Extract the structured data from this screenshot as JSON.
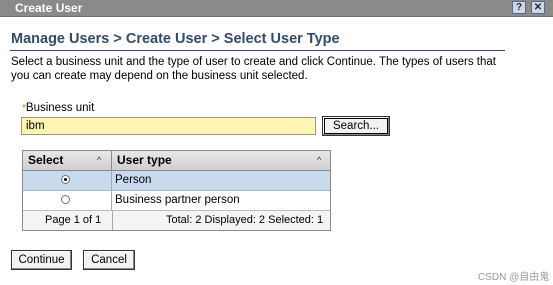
{
  "window": {
    "title": "Create User",
    "help_glyph": "?",
    "close_glyph": "✕"
  },
  "page": {
    "heading": "Manage Users > Create User > Select User Type",
    "description": "Select a business unit and the type of user to create and click Continue. The types of users that you can create may depend on the business unit selected."
  },
  "business_unit": {
    "required_marker": "*",
    "label": "Business unit",
    "value": "ibm",
    "search_label": "Search..."
  },
  "table": {
    "columns": [
      "Select",
      "User type"
    ],
    "sort_glyph": "^",
    "rows": [
      {
        "type": "Person",
        "selected": true
      },
      {
        "type": "Business partner person",
        "selected": false
      }
    ],
    "page_info": "Page 1 of 1",
    "stats": "Total: 2  Displayed: 2  Selected: 1"
  },
  "actions": {
    "continue_label": "Continue",
    "cancel_label": "Cancel"
  },
  "watermark": "CSDN @自由鬼",
  "colors": {
    "titlebar": "#8a8a8a",
    "heading": "#324a6e",
    "input_bg": "#fdf5b4",
    "selected_row": "#c9d9ee"
  }
}
